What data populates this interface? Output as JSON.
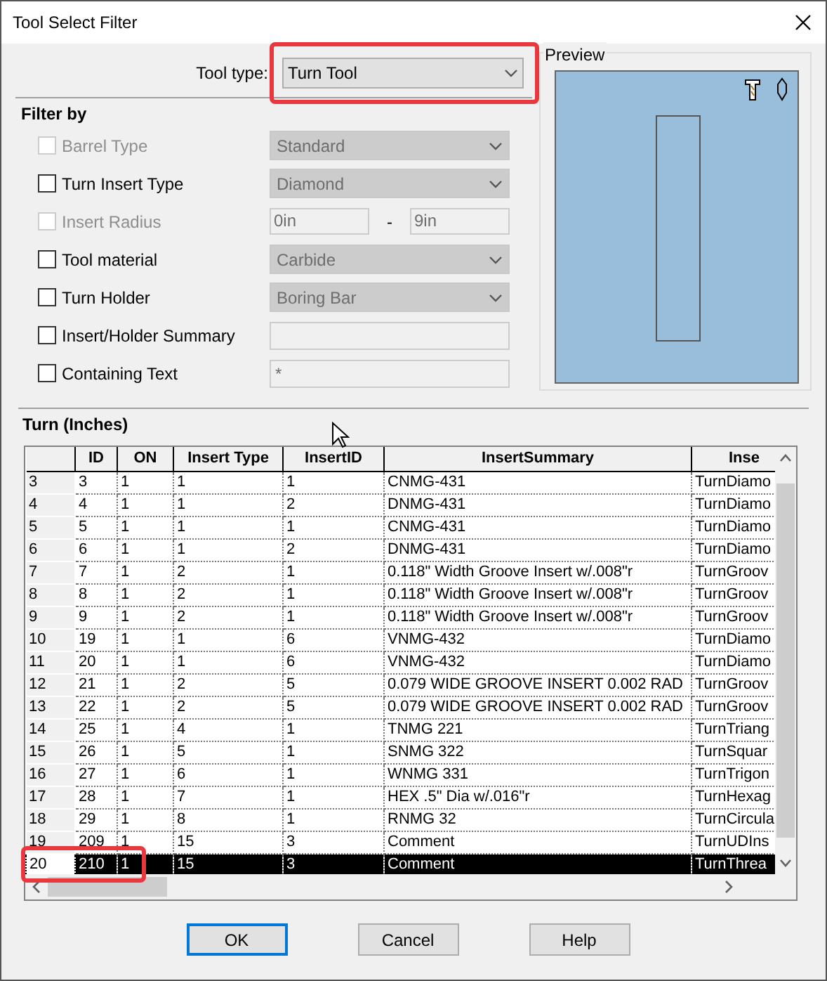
{
  "window": {
    "title": "Tool Select Filter"
  },
  "tool_type": {
    "label": "Tool type:",
    "value": "Turn Tool",
    "annotated": true
  },
  "filter": {
    "title": "Filter by",
    "items": [
      {
        "kind": "combo",
        "label": "Barrel Type",
        "checked": false,
        "disabled": true,
        "value": "Standard"
      },
      {
        "kind": "combo",
        "label": "Turn Insert Type",
        "checked": false,
        "disabled": false,
        "value": "Diamond"
      },
      {
        "kind": "range",
        "label": "Insert Radius",
        "checked": false,
        "disabled": true,
        "from": "0in",
        "separator": "-",
        "to": "9in"
      },
      {
        "kind": "combo",
        "label": "Tool material",
        "checked": false,
        "disabled": false,
        "value": "Carbide"
      },
      {
        "kind": "combo",
        "label": "Turn Holder",
        "checked": false,
        "disabled": false,
        "value": "Boring Bar"
      },
      {
        "kind": "text",
        "label": "Insert/Holder Summary",
        "checked": false,
        "disabled": false
      },
      {
        "kind": "text",
        "label": "Containing Text",
        "checked": false,
        "disabled": false,
        "value": "*"
      }
    ]
  },
  "preview": {
    "title": "Preview"
  },
  "grid": {
    "title": "Turn (Inches)",
    "columns": [
      "ID",
      "ON",
      "Insert Type",
      "InsertID",
      "InsertSummary",
      "Inse"
    ],
    "rows": [
      {
        "header": "3",
        "cells": [
          "3",
          "1",
          "1",
          "1",
          "CNMG-431",
          "TurnDiamo"
        ],
        "selected": false,
        "annotated": false
      },
      {
        "header": "4",
        "cells": [
          "4",
          "1",
          "1",
          "2",
          "DNMG-431",
          "TurnDiamo"
        ],
        "selected": false,
        "annotated": false
      },
      {
        "header": "5",
        "cells": [
          "5",
          "1",
          "1",
          "1",
          "CNMG-431",
          "TurnDiamo"
        ],
        "selected": false,
        "annotated": false
      },
      {
        "header": "6",
        "cells": [
          "6",
          "1",
          "1",
          "2",
          "DNMG-431",
          "TurnDiamo"
        ],
        "selected": false,
        "annotated": false
      },
      {
        "header": "7",
        "cells": [
          "7",
          "1",
          "2",
          "1",
          "0.118\" Width Groove Insert w/.008\"r",
          "TurnGroov"
        ],
        "selected": false,
        "annotated": false
      },
      {
        "header": "8",
        "cells": [
          "8",
          "1",
          "2",
          "1",
          "0.118\" Width Groove Insert w/.008\"r",
          "TurnGroov"
        ],
        "selected": false,
        "annotated": false
      },
      {
        "header": "9",
        "cells": [
          "9",
          "1",
          "2",
          "1",
          "0.118\" Width Groove Insert w/.008\"r",
          "TurnGroov"
        ],
        "selected": false,
        "annotated": false
      },
      {
        "header": "10",
        "cells": [
          "19",
          "1",
          "1",
          "6",
          "VNMG-432",
          "TurnDiamo"
        ],
        "selected": false,
        "annotated": false
      },
      {
        "header": "11",
        "cells": [
          "20",
          "1",
          "1",
          "6",
          "VNMG-432",
          "TurnDiamo"
        ],
        "selected": false,
        "annotated": false
      },
      {
        "header": "12",
        "cells": [
          "21",
          "1",
          "2",
          "5",
          "0.079 WIDE GROOVE INSERT 0.002 RAD",
          "TurnGroov"
        ],
        "selected": false,
        "annotated": false
      },
      {
        "header": "13",
        "cells": [
          "22",
          "1",
          "2",
          "5",
          "0.079 WIDE GROOVE INSERT 0.002 RAD",
          "TurnGroov"
        ],
        "selected": false,
        "annotated": false
      },
      {
        "header": "14",
        "cells": [
          "25",
          "1",
          "4",
          "1",
          "TNMG 221",
          "TurnTriang"
        ],
        "selected": false,
        "annotated": false
      },
      {
        "header": "15",
        "cells": [
          "26",
          "1",
          "5",
          "1",
          "SNMG 322",
          "TurnSquar"
        ],
        "selected": false,
        "annotated": false
      },
      {
        "header": "16",
        "cells": [
          "27",
          "1",
          "6",
          "1",
          "WNMG 331",
          "TurnTrigon"
        ],
        "selected": false,
        "annotated": false
      },
      {
        "header": "17",
        "cells": [
          "28",
          "1",
          "7",
          "1",
          "HEX .5\" Dia w/.016\"r",
          "TurnHexag"
        ],
        "selected": false,
        "annotated": false
      },
      {
        "header": "18",
        "cells": [
          "29",
          "1",
          "8",
          "1",
          "RNMG 32",
          "TurnCircula"
        ],
        "selected": false,
        "annotated": false
      },
      {
        "header": "19",
        "cells": [
          "209",
          "1",
          "15",
          "3",
          "Comment",
          "TurnUDIns"
        ],
        "selected": false,
        "annotated": false
      },
      {
        "header": "20",
        "cells": [
          "210",
          "1",
          "15",
          "3",
          "Comment",
          "TurnThrea"
        ],
        "selected": true,
        "annotated": true
      }
    ]
  },
  "buttons": [
    {
      "label": "OK",
      "default": true
    },
    {
      "label": "Cancel",
      "default": false
    },
    {
      "label": "Help",
      "default": false
    }
  ]
}
